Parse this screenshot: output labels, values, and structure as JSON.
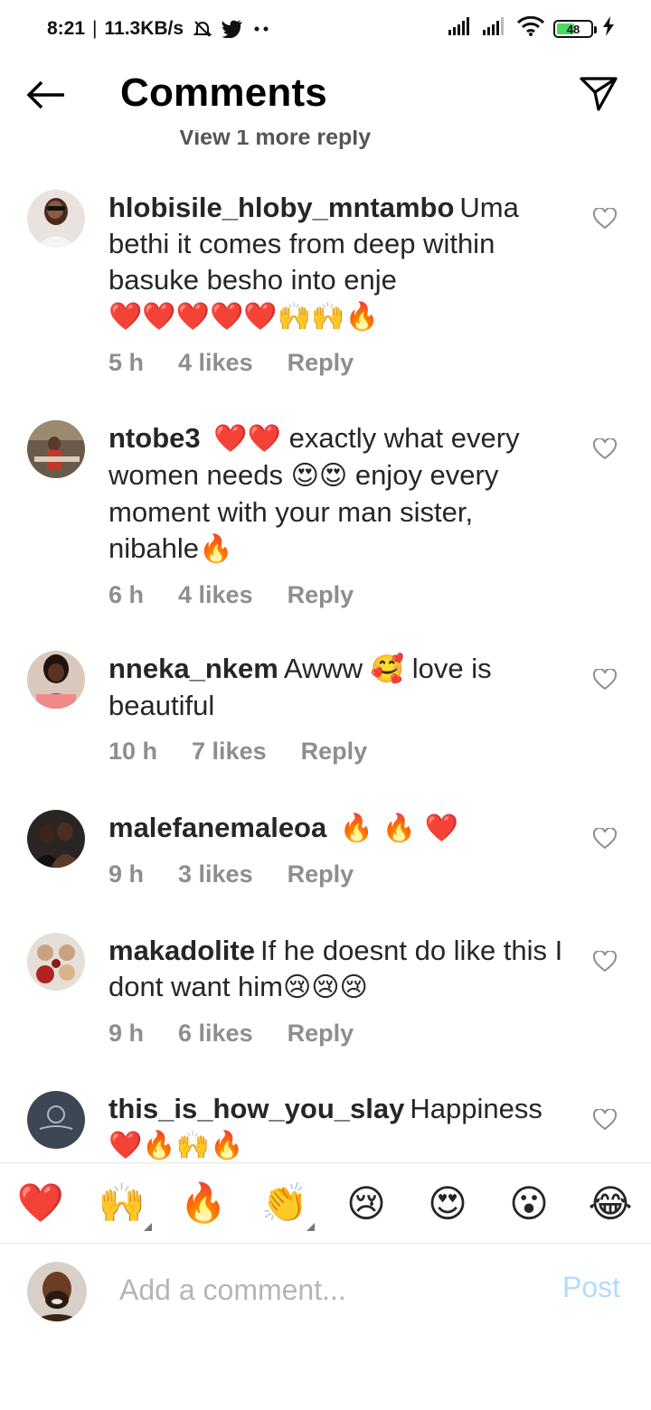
{
  "status_bar": {
    "time": "8:21",
    "network_speed": "11.3KB/s",
    "battery_level": "48",
    "icons": [
      "mute-bell-icon",
      "twitter-icon",
      "more-dots-icon",
      "signal-icon",
      "signal-icon",
      "wifi-icon",
      "battery-icon",
      "charging-icon"
    ]
  },
  "header": {
    "title": "Comments",
    "back_icon": "arrow-left-icon",
    "share_icon": "paper-plane-icon"
  },
  "view_more_replies": "View 1 more reply",
  "comments": [
    {
      "username": "hlobisile_hloby_mntambo",
      "text": "Uma bethi it comes from deep within basuke besho into enje",
      "emoji": "❤️❤️❤️❤️❤️🙌🙌🔥",
      "time": "5 h",
      "likes": "4 likes",
      "reply": "Reply"
    },
    {
      "username": "ntobe3",
      "emoji_pre": "❤️❤️",
      "text": "exactly what every women needs",
      "emoji_mid": "😍😍",
      "text2": "enjoy every moment with your man sister, nibahle",
      "emoji": "🔥",
      "time": "6 h",
      "likes": "4 likes",
      "reply": "Reply"
    },
    {
      "username": "nneka_nkem",
      "text": "Awww",
      "emoji_mid": "🥰",
      "text2": "love is beautiful",
      "time": "10 h",
      "likes": "7 likes",
      "reply": "Reply"
    },
    {
      "username": "malefanemaleoa",
      "emoji": "🔥 🔥 ❤️",
      "time": "9 h",
      "likes": "3 likes",
      "reply": "Reply"
    },
    {
      "username": "makadolite",
      "text": "If he doesnt do like this I dont want him",
      "emoji": "😢😢😢",
      "time": "9 h",
      "likes": "6 likes",
      "reply": "Reply"
    },
    {
      "username": "this_is_how_you_slay",
      "text": "Happiness",
      "emoji": "❤️🔥🙌🔥"
    }
  ],
  "emoji_bar": [
    "❤️",
    "🙌",
    "🔥",
    "👏",
    "😢",
    "😍",
    "😮",
    "😂"
  ],
  "composer": {
    "placeholder": "Add a comment...",
    "post_label": "Post"
  },
  "colors": {
    "meta_gray": "#8e8e8e",
    "post_disabled": "#b3dbff",
    "heart_red": "#ed4956"
  }
}
